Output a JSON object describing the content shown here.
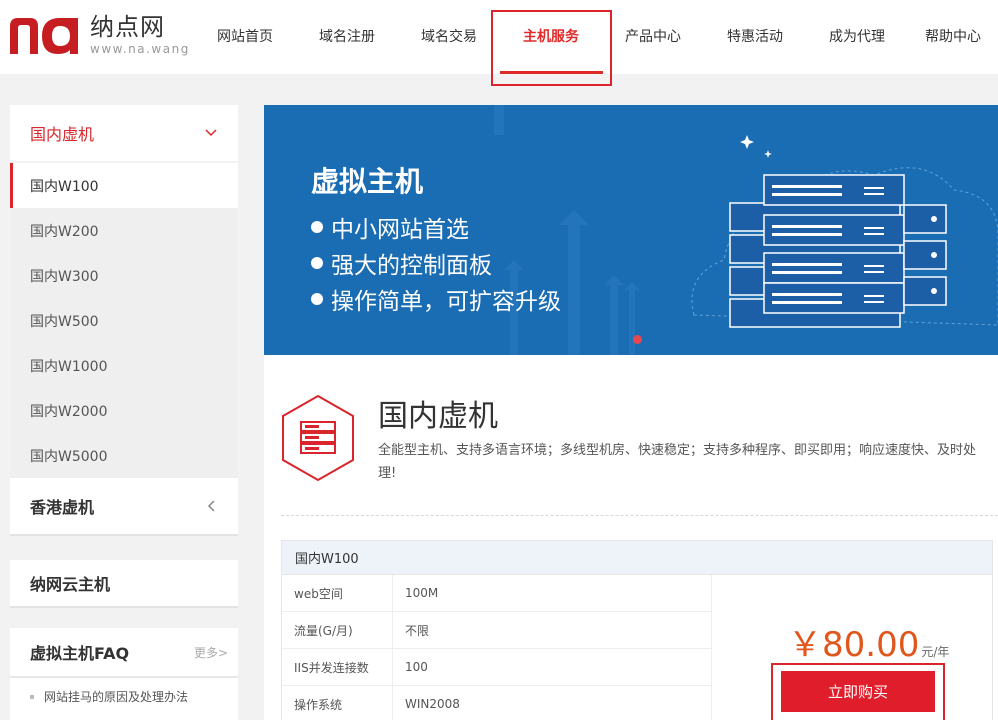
{
  "logo": {
    "cn": "纳点网",
    "en": "www.na.wang"
  },
  "nav": [
    {
      "label": "网站首页",
      "active": false
    },
    {
      "label": "域名注册",
      "active": false
    },
    {
      "label": "域名交易",
      "active": false
    },
    {
      "label": "主机服务",
      "active": true
    },
    {
      "label": "产品中心",
      "active": false
    },
    {
      "label": "特惠活动",
      "active": false
    },
    {
      "label": "成为代理",
      "active": false
    },
    {
      "label": "帮助中心",
      "active": false
    }
  ],
  "sidebar": {
    "domestic": {
      "title": "国内虚机",
      "items": [
        "国内W100",
        "国内W200",
        "国内W300",
        "国内W500",
        "国内W1000",
        "国内W2000",
        "国内W5000"
      ]
    },
    "hongkong": {
      "title": "香港虚机"
    },
    "cloud": {
      "title": "纳网云主机"
    },
    "faq": {
      "title": "虚拟主机FAQ",
      "more": "更多>",
      "items": [
        "网站挂马的原因及处理办法"
      ]
    }
  },
  "banner": {
    "title": "虚拟主机",
    "points": [
      "中小网站首选",
      "强大的控制面板",
      "操作简单，可扩容升级"
    ]
  },
  "product": {
    "title": "国内虚机",
    "description": "全能型主机、支持多语言环境；多线型机房、快速稳定；支持多种程序、即买即用；响应速度快、及时处理!",
    "plan": "国内W100",
    "specs": [
      {
        "label": "web空间",
        "value": "100M"
      },
      {
        "label": "流量(G/月)",
        "value": "不限"
      },
      {
        "label": "IIS并发连接数",
        "value": "100"
      },
      {
        "label": "操作系统",
        "value": "WIN2008"
      }
    ],
    "price": "￥80.00",
    "price_unit": "元/年",
    "buy_label": "立即购买"
  },
  "colors": {
    "accent": "#e01d2a",
    "banner_bg": "#1a6cb3",
    "price": "#e0561d"
  }
}
